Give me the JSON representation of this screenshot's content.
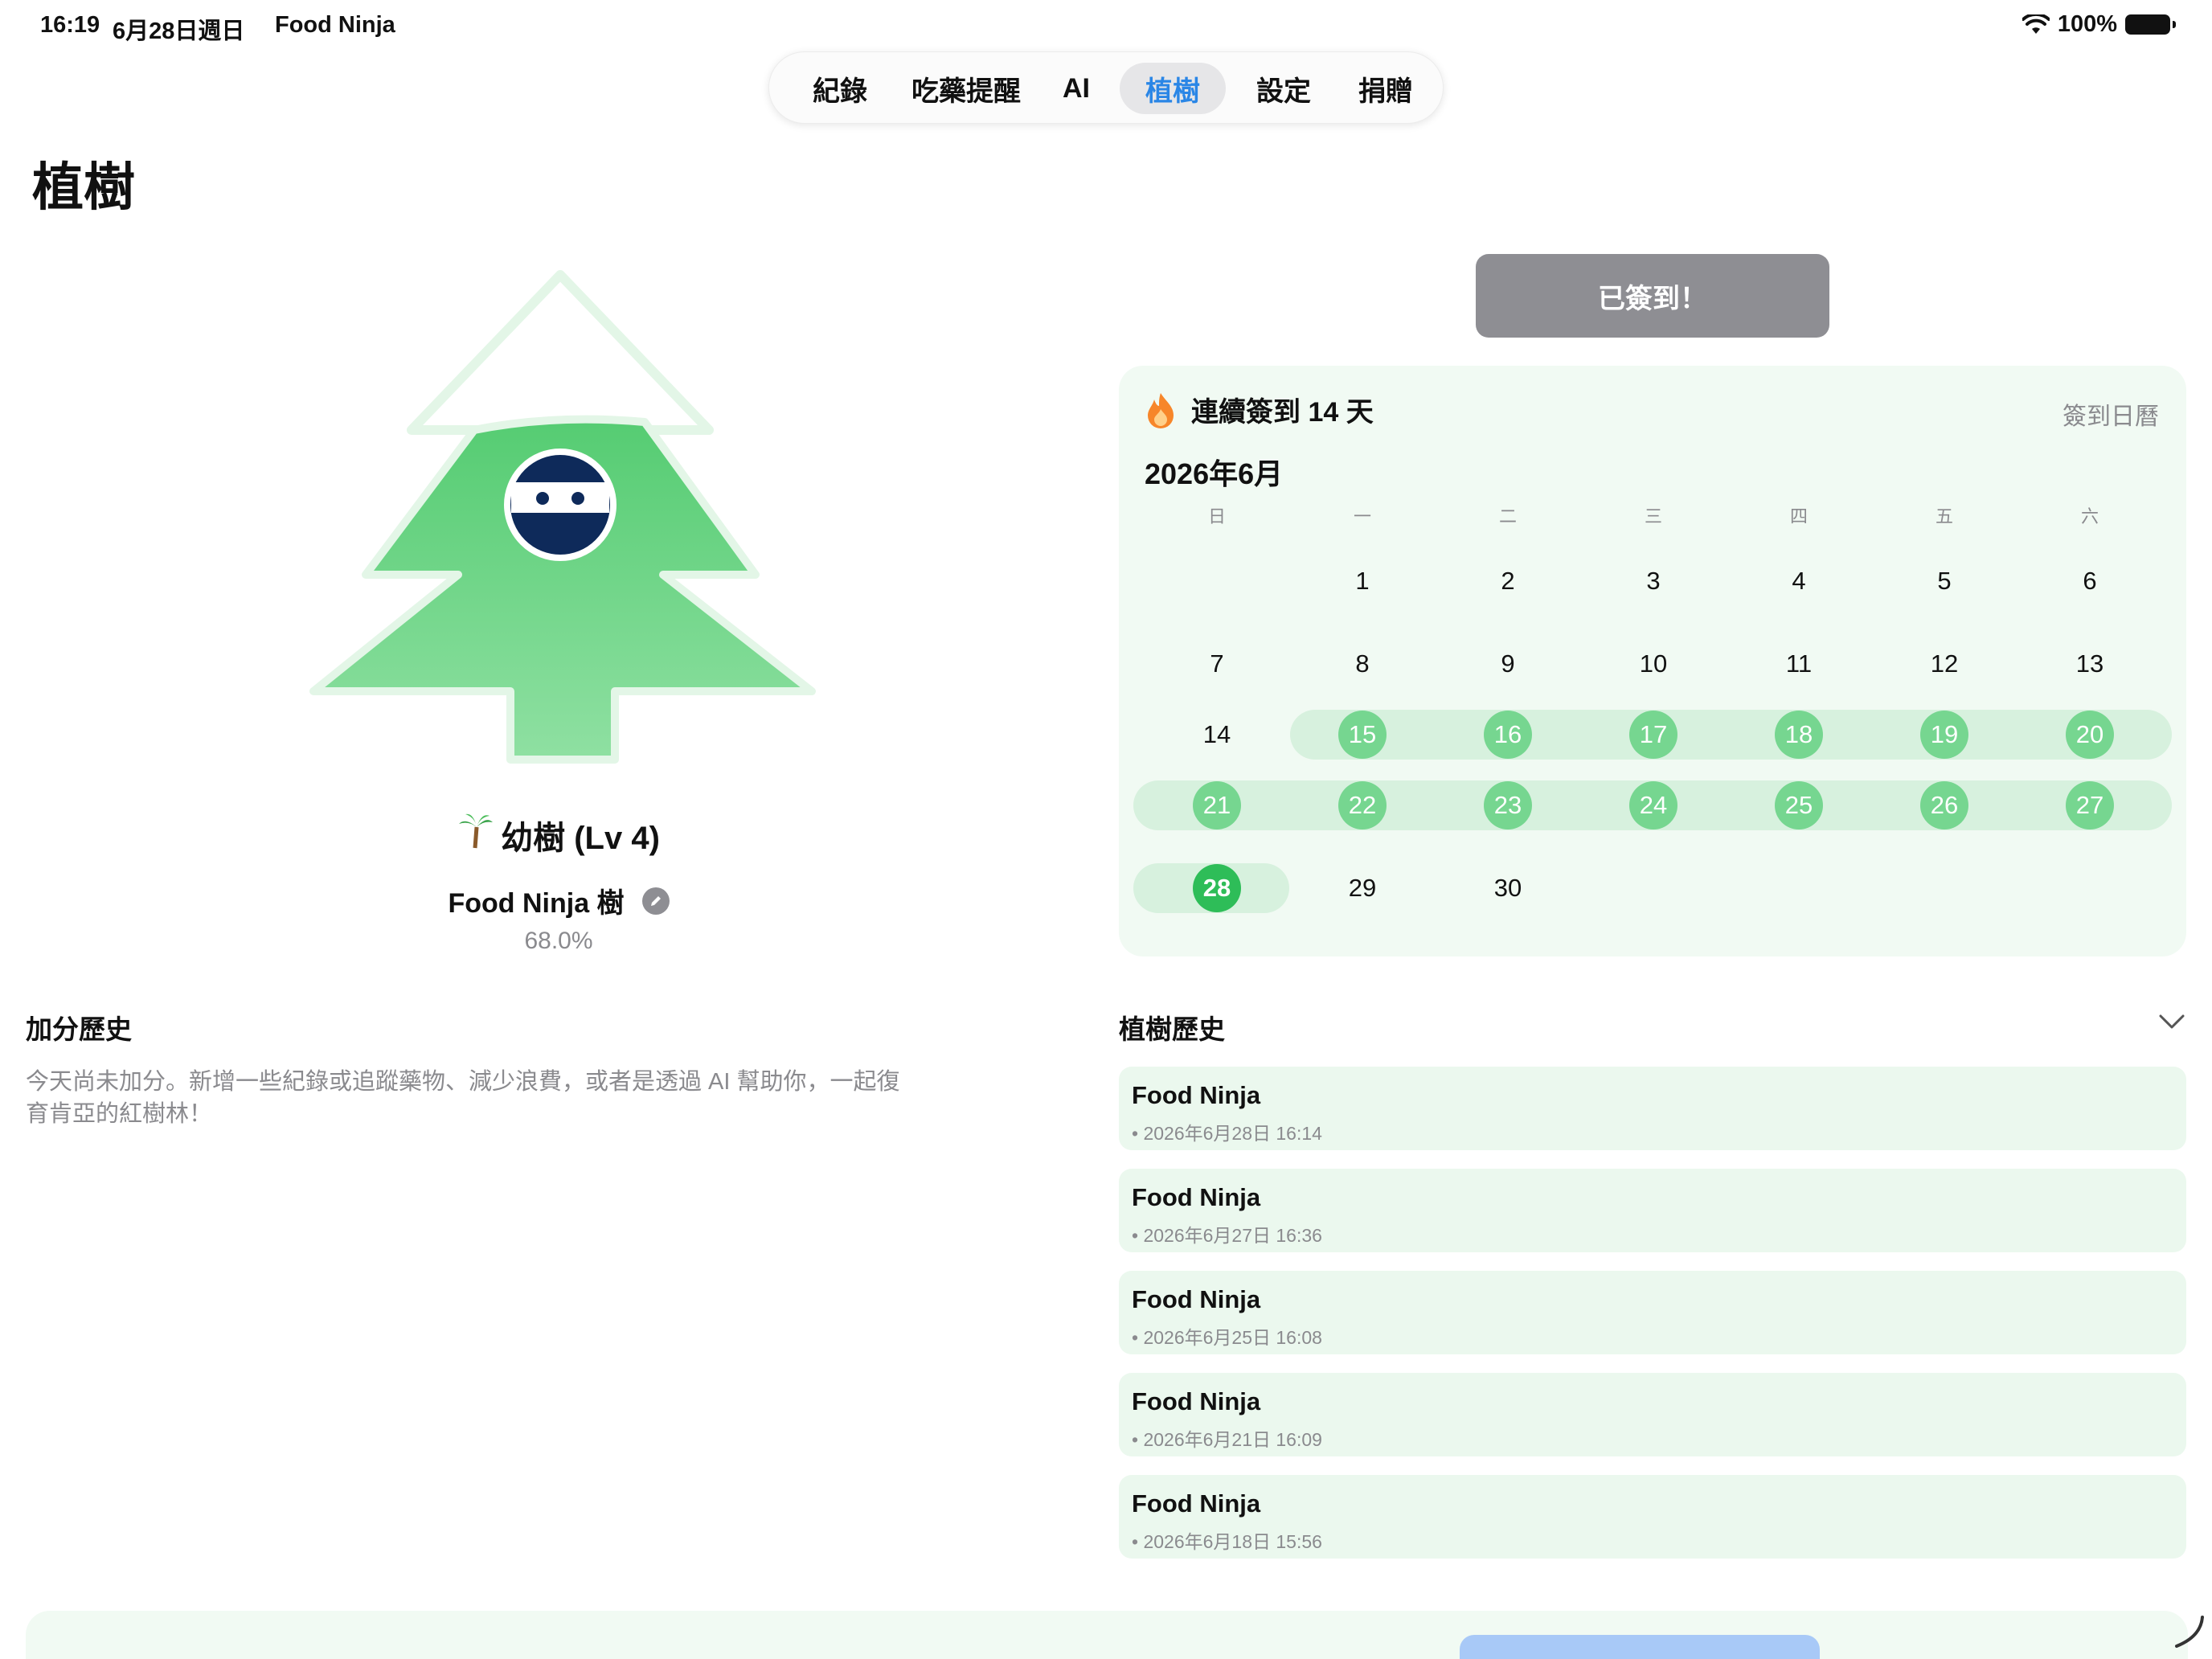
{
  "status_bar": {
    "time": "16:19",
    "date": "6月28日週日",
    "app_name": "Food Ninja",
    "battery": "100%"
  },
  "tabs": [
    {
      "label": "紀錄",
      "active": false
    },
    {
      "label": "吃藥提醒",
      "active": false
    },
    {
      "label": "AI",
      "active": false
    },
    {
      "label": "植樹",
      "active": true
    },
    {
      "label": "設定",
      "active": false
    },
    {
      "label": "捐贈",
      "active": false
    }
  ],
  "page_title": "植樹",
  "tree": {
    "level_label": "幼樹 (Lv 4)",
    "name": "Food Ninja 樹",
    "progress_text": "68.0%",
    "progress": 0.68,
    "colors": {
      "fill": "#5fd07a",
      "pale": "#e7f7ea",
      "ninja": "#0e2a5a"
    }
  },
  "checkin": {
    "button_label": "已簽到！"
  },
  "calendar": {
    "streak_label": "連續簽到 14 天",
    "link_label": "簽到日曆",
    "month_label": "2026年6月",
    "weekdays": [
      "日",
      "一",
      "二",
      "三",
      "四",
      "五",
      "六"
    ],
    "weeks": [
      [
        "",
        "1",
        "2",
        "3",
        "4",
        "5",
        "6"
      ],
      [
        "7",
        "8",
        "9",
        "10",
        "11",
        "12",
        "13"
      ],
      [
        "14",
        "15",
        "16",
        "17",
        "18",
        "19",
        "20"
      ],
      [
        "21",
        "22",
        "23",
        "24",
        "25",
        "26",
        "27"
      ],
      [
        "28",
        "29",
        "30",
        "",
        "",
        "",
        ""
      ]
    ],
    "checked_days": [
      15,
      16,
      17,
      18,
      19,
      20,
      21,
      22,
      23,
      24,
      25,
      26,
      27
    ],
    "today": 28,
    "colors": {
      "checked": "#76d690",
      "today": "#2ebd58",
      "band": "#d7f1de"
    }
  },
  "bonus_history": {
    "title": "加分歷史",
    "empty_text": "今天尚未加分。新增一些紀錄或追蹤藥物、減少浪費，或者是透過 AI 幫助你，一起復育肯亞的紅樹林！"
  },
  "planting_history": {
    "title": "植樹歷史",
    "items": [
      {
        "name": "Food Ninja",
        "date": "• 2026年6月28日 16:14"
      },
      {
        "name": "Food Ninja",
        "date": "• 2026年6月27日 16:36"
      },
      {
        "name": "Food Ninja",
        "date": "• 2026年6月25日 16:08"
      },
      {
        "name": "Food Ninja",
        "date": "• 2026年6月21日 16:09"
      },
      {
        "name": "Food Ninja",
        "date": "• 2026年6月18日 15:56"
      }
    ]
  }
}
